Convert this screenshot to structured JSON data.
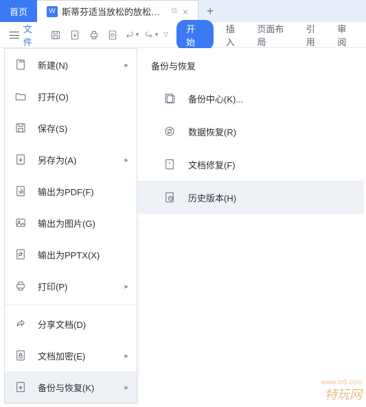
{
  "tabs": {
    "home": "首页",
    "doc_icon": "W",
    "doc_title": "斯蒂芬适当放松的放松的.docx",
    "device_glyph": "⧉",
    "close_glyph": "×",
    "new_glyph": "+"
  },
  "toolbar": {
    "file_label": "文件",
    "start": "开始",
    "items": [
      "插入",
      "页面布局",
      "引用",
      "审阅"
    ]
  },
  "file_menu": {
    "items": [
      {
        "label": "新建(N)",
        "icon": "new",
        "chevron": true
      },
      {
        "label": "打开(O)",
        "icon": "open",
        "chevron": false
      },
      {
        "label": "保存(S)",
        "icon": "save",
        "chevron": false
      },
      {
        "label": "另存为(A)",
        "icon": "saveas",
        "chevron": true
      },
      {
        "label": "输出为PDF(F)",
        "icon": "pdf",
        "chevron": false
      },
      {
        "label": "输出为图片(G)",
        "icon": "image",
        "chevron": false
      },
      {
        "label": "输出为PPTX(X)",
        "icon": "pptx",
        "chevron": false
      },
      {
        "label": "打印(P)",
        "icon": "print",
        "chevron": true
      },
      {
        "label": "分享文档(D)",
        "icon": "share",
        "chevron": false
      },
      {
        "label": "文档加密(E)",
        "icon": "encrypt",
        "chevron": true
      },
      {
        "label": "备份与恢复(K)",
        "icon": "backup",
        "chevron": true,
        "active": true
      }
    ],
    "separator_after_index": 7
  },
  "submenu": {
    "title": "备份与恢复",
    "items": [
      {
        "label": "备份中心(K)...",
        "icon": "backup-center"
      },
      {
        "label": "数据恢复(R)",
        "icon": "data-recover"
      },
      {
        "label": "文档修复(F)",
        "icon": "doc-repair"
      },
      {
        "label": "历史版本(H)",
        "icon": "history",
        "active": true
      }
    ]
  },
  "watermark": {
    "line1": "特玩网",
    "line2": "www.te5.com"
  }
}
